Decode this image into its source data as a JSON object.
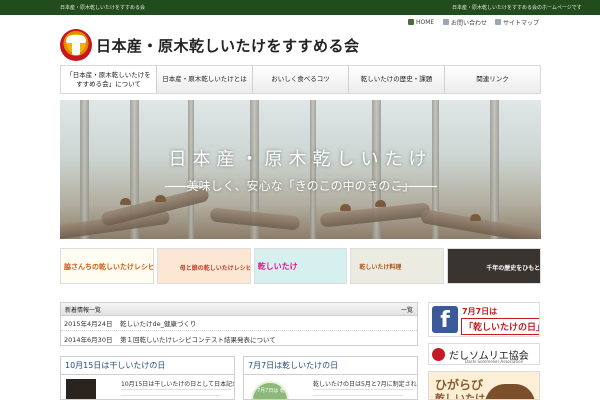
{
  "topbar": {
    "left_text": "日本産・原木乾しいたけをすすめる会",
    "right_text": "日本産・原木乾しいたけをすすめる会のホームページです"
  },
  "utility": {
    "home": "HOME",
    "contact": "お問い合わせ",
    "sitemap": "サイトマップ"
  },
  "site": {
    "title": "日本産・原木乾しいたけをすすめる会"
  },
  "nav": [
    {
      "label": "「日本産・原木乾しいたけを\nすすめる会」について"
    },
    {
      "label": "日本産・原木乾しいたけとは"
    },
    {
      "label": "おいしく食べるコツ"
    },
    {
      "label": "乾しいたけの歴史・課題"
    },
    {
      "label": "関連リンク"
    }
  ],
  "hero": {
    "title": "日本産・原木乾しいたけ",
    "subtitle": "美味しく、安心な「きのこの中のきのこ」"
  },
  "banners": [
    {
      "text": "脇さんちの乾しいたけレシピ"
    },
    {
      "text": "母と娘の乾しいたけレシピ"
    },
    {
      "text": "乾しいたけ"
    },
    {
      "text": "乾しいたけ料理"
    },
    {
      "text": "千年の歴史をひもとく"
    }
  ],
  "news": {
    "heading": "新着情報一覧",
    "close": "一覧",
    "items": [
      {
        "date": "2015年4月24日",
        "title": "乾しいたけde_健康づくり"
      },
      {
        "date": "2014年6月30日",
        "title": "第１回乾しいたけレシピコンテスト結果発表について"
      }
    ]
  },
  "cards": [
    {
      "heading": "10月15日は干しいたけの日",
      "text": "10月15日は干しいたけの日として日本記念日協会に登録されています。"
    },
    {
      "heading": "7月7日は乾しいたけの日",
      "thumb_text": "7月7日は 乾しいたけの日",
      "text": "乾しいたけの日は5月と7月に制定されています。"
    }
  ],
  "sidebar": {
    "facebook": {
      "line1": "7月7日は",
      "line2": "「乾しいたけの日」"
    },
    "association": {
      "title": "だしソムリエ協会",
      "sub": "Dashi Sommelier Association"
    },
    "higarabi": {
      "line1": "ひがらび",
      "line2": "乾しいたけ"
    }
  },
  "colors": {
    "topbar": "#214d1e",
    "link": "#244f7a",
    "accent_red": "#c41a21",
    "facebook_blue": "#3b5998"
  }
}
